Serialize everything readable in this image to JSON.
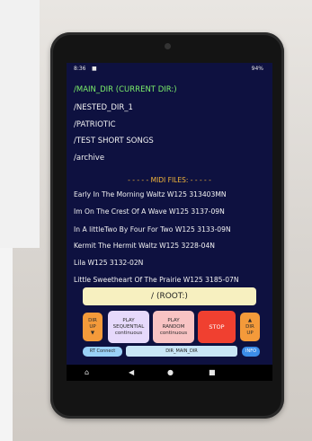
{
  "status_bar": {
    "time": "8:36",
    "symbol": "■",
    "battery": "94%"
  },
  "directories": [
    "/MAIN_DIR (CURRENT DIR:)",
    "/NESTED_DIR_1",
    "/PATRIOTIC",
    "/TEST SHORT SONGS",
    "/archive"
  ],
  "midi_header": "- - - - - MIDI FILES: - - - - -",
  "songs": [
    "Early In The Morning Waltz W125 313403MN",
    "Im On The Crest Of A Wave W125 3137-09N",
    "In A littleTwo By Four For Two W125 3133-09N",
    "Kermit The Hermit  Waltz W125 3228-04N",
    "Lila W125 3132-02N",
    "Little Sweetheart Of The Prairie W125 3185-07N"
  ],
  "root_label": "/ (ROOT:)",
  "controls": {
    "dir_up_left": [
      "DIR",
      "UP",
      "▼"
    ],
    "play_sequential": [
      "PLAY",
      "SEQUENTIAL",
      "continuous"
    ],
    "play_random": [
      "PLAY",
      "RANDOM",
      "continuous"
    ],
    "stop": "STOP",
    "dir_up_right": [
      "▲",
      "DIR",
      "UP"
    ],
    "rt_connect": "RT Connect",
    "path": "DIR_MAIN_DIR",
    "info": "INFO"
  },
  "navbar": {
    "home_icon": "⌂",
    "back_icon": "◀",
    "center_icon": "●",
    "recents_icon": "■"
  }
}
